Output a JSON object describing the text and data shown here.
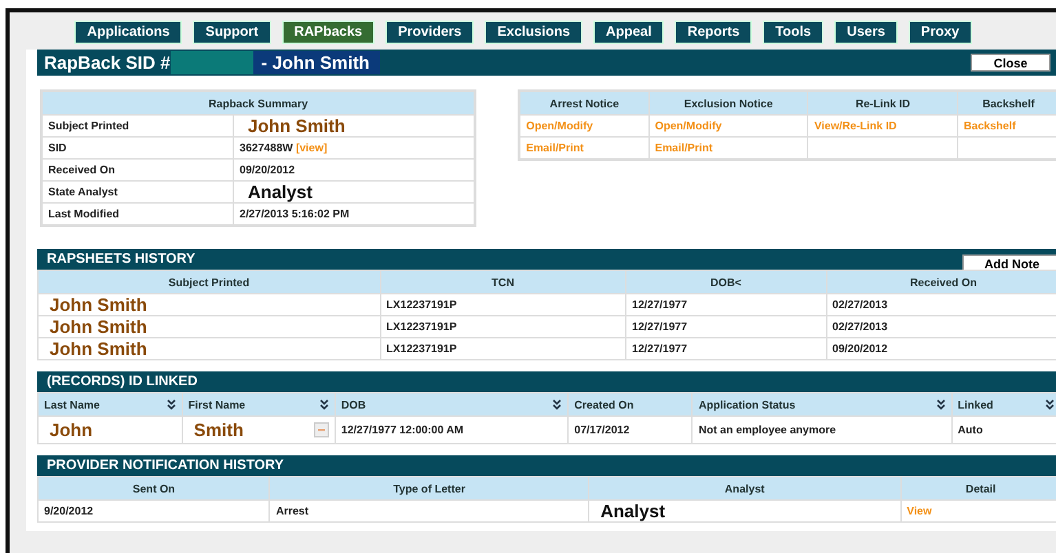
{
  "nav": [
    {
      "label": "Applications",
      "selected": false
    },
    {
      "label": "Support",
      "selected": false
    },
    {
      "label": "RAPbacks",
      "selected": true
    },
    {
      "label": "Providers",
      "selected": false
    },
    {
      "label": "Exclusions",
      "selected": false
    },
    {
      "label": "Appeal",
      "selected": false
    },
    {
      "label": "Reports",
      "selected": false
    },
    {
      "label": "Tools",
      "selected": false
    },
    {
      "label": "Users",
      "selected": false
    },
    {
      "label": "Proxy",
      "selected": false
    }
  ],
  "title_bar": {
    "label": "RapBack SID #",
    "name": "- John Smith",
    "close": "Close"
  },
  "summary": {
    "heading": "Rapback Summary",
    "rows": [
      {
        "label": "Subject Printed",
        "value": "John Smith",
        "kind": "big-name"
      },
      {
        "label": "SID",
        "value": "3627488W",
        "link": "[view]",
        "kind": "link"
      },
      {
        "label": "Received On",
        "value": "09/20/2012",
        "kind": "plain"
      },
      {
        "label": "State Analyst",
        "value": "Analyst",
        "kind": "big"
      },
      {
        "label": "Last Modified",
        "value": "2/27/2013 5:16:02 PM",
        "kind": "plain"
      }
    ]
  },
  "actions": {
    "columns": [
      "Arrest Notice",
      "Exclusion Notice",
      "Re-Link ID",
      "Backshelf"
    ],
    "rows": [
      [
        "Open/Modify",
        "Open/Modify",
        "View/Re-Link ID",
        "Backshelf"
      ],
      [
        "Email/Print",
        "Email/Print",
        "",
        ""
      ]
    ]
  },
  "rapsheets": {
    "title": "RAPSHEETS HISTORY",
    "button": "Add Note",
    "columns": [
      "Subject Printed",
      "TCN",
      "DOB<",
      "Received On"
    ],
    "rows": [
      [
        "John Smith",
        "LX12237191P",
        "12/27/1977",
        "02/27/2013"
      ],
      [
        "John Smith",
        "LX12237191P",
        "12/27/1977",
        "02/27/2013"
      ],
      [
        "John Smith",
        "LX12237191P",
        "12/27/1977",
        "09/20/2012"
      ]
    ]
  },
  "records": {
    "title": "(RECORDS) ID LINKED",
    "columns": [
      "Last Name",
      "First Name",
      "DOB",
      "Created On",
      "Application Status",
      "Linked"
    ],
    "rows": [
      [
        "John",
        "Smith",
        "12/27/1977 12:00:00 AM",
        "07/17/2012",
        "Not an employee anymore",
        "Auto"
      ]
    ]
  },
  "notifications": {
    "title": "PROVIDER NOTIFICATION HISTORY",
    "columns": [
      "Sent On",
      "Type of Letter",
      "Analyst",
      "Detail"
    ],
    "rows": [
      [
        "9/20/2012",
        "Arrest",
        "Analyst",
        "View"
      ]
    ]
  }
}
